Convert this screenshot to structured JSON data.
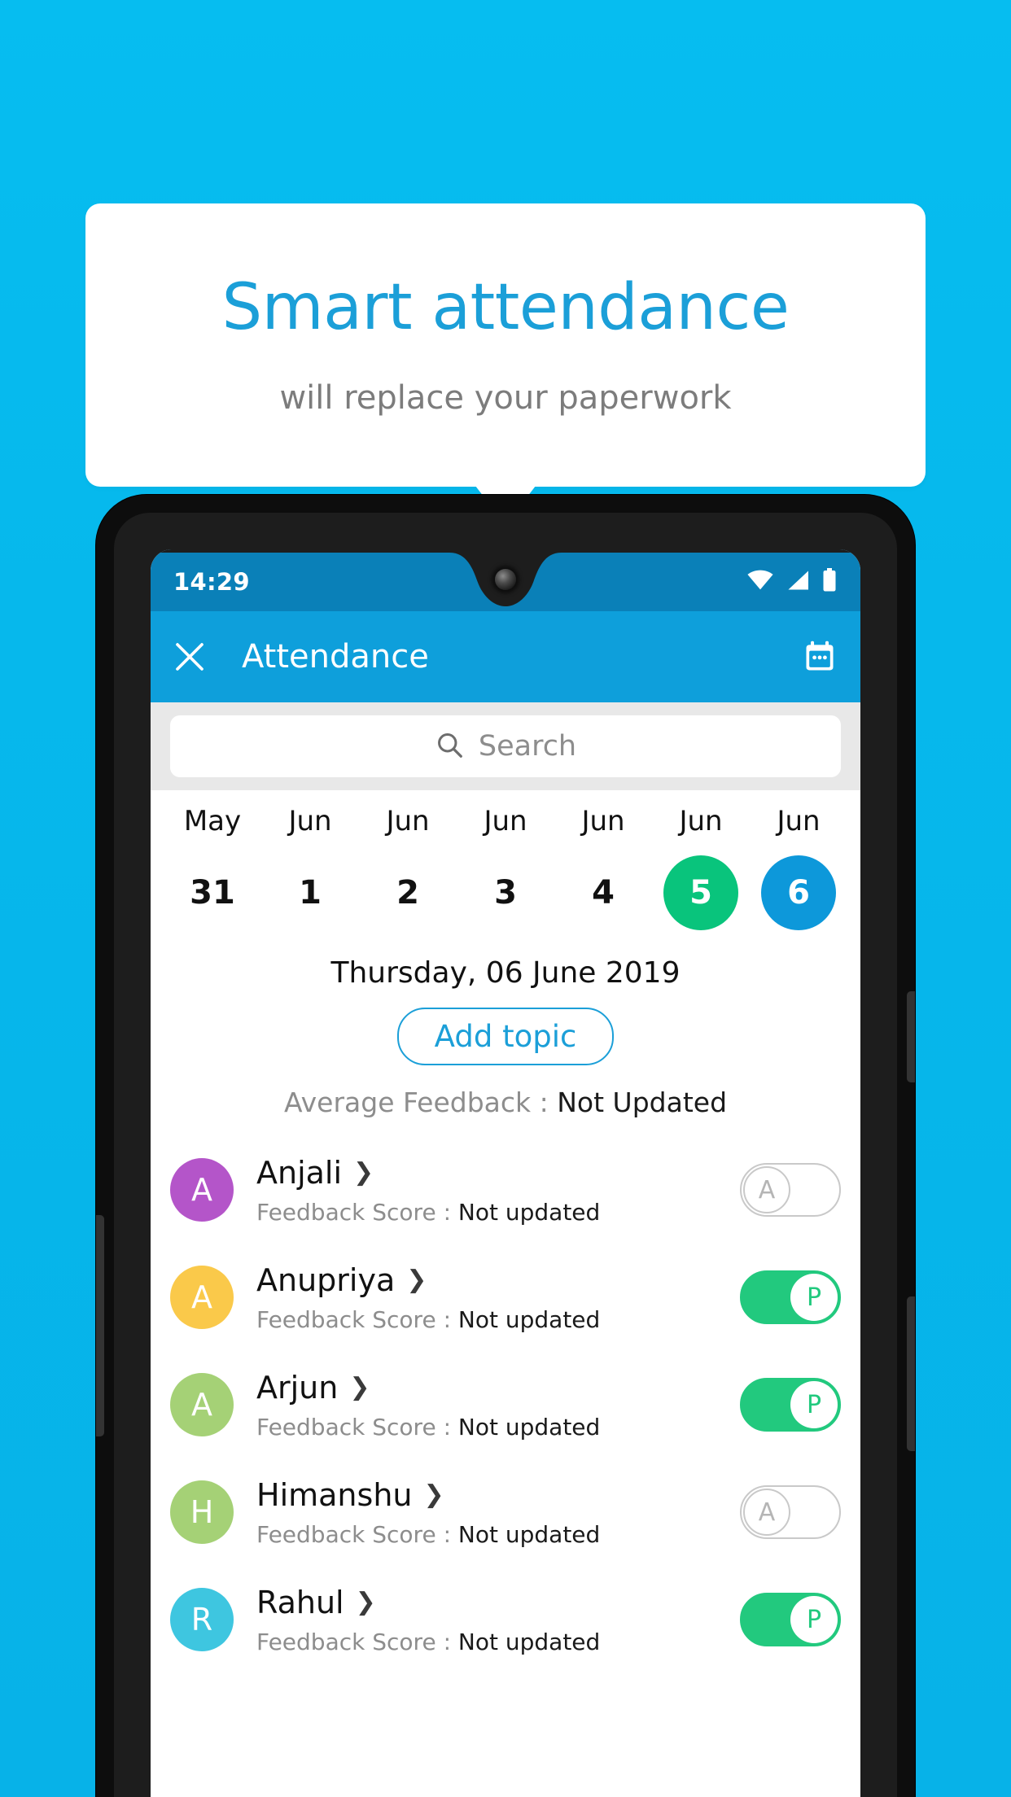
{
  "promo": {
    "title": "Smart attendance",
    "subtitle": "will replace your paperwork",
    "title_color": "#1b9fd8",
    "background_color": "#06b8ec"
  },
  "phone": {
    "status_bar": {
      "time": "14:29",
      "icons": [
        "wifi-icon",
        "signal-icon",
        "battery-icon"
      ],
      "background_color": "#0a80b8"
    },
    "app_bar": {
      "close_label": "close-icon",
      "title": "Attendance",
      "action_label": "calendar-icon",
      "background_color": "#0e9fdb"
    },
    "search": {
      "placeholder": "Search",
      "value": ""
    },
    "dates": [
      {
        "month": "May",
        "day": "31",
        "state": "none"
      },
      {
        "month": "Jun",
        "day": "1",
        "state": "none"
      },
      {
        "month": "Jun",
        "day": "2",
        "state": "none"
      },
      {
        "month": "Jun",
        "day": "3",
        "state": "none"
      },
      {
        "month": "Jun",
        "day": "4",
        "state": "none"
      },
      {
        "month": "Jun",
        "day": "5",
        "state": "green"
      },
      {
        "month": "Jun",
        "day": "6",
        "state": "blue"
      }
    ],
    "selected_date_label": "Thursday, 06 June 2019",
    "add_topic_label": "Add topic",
    "average_feedback": {
      "label": "Average Feedback :",
      "value": "Not Updated"
    },
    "feedback_score_label": "Feedback Score :",
    "students": [
      {
        "name": "Anjali",
        "initial": "A",
        "avatar_color": "#b455c9",
        "feedback": "Not updated",
        "attendance": "A",
        "state": "absent"
      },
      {
        "name": "Anupriya",
        "initial": "A",
        "avatar_color": "#fac94a",
        "feedback": "Not updated",
        "attendance": "P",
        "state": "present"
      },
      {
        "name": "Arjun",
        "initial": "A",
        "avatar_color": "#a5d176",
        "feedback": "Not updated",
        "attendance": "P",
        "state": "present"
      },
      {
        "name": "Himanshu",
        "initial": "H",
        "avatar_color": "#a5d176",
        "feedback": "Not updated",
        "attendance": "A",
        "state": "absent"
      },
      {
        "name": "Rahul",
        "initial": "R",
        "avatar_color": "#3ec6e0",
        "feedback": "Not updated",
        "attendance": "P",
        "state": "present"
      }
    ]
  }
}
